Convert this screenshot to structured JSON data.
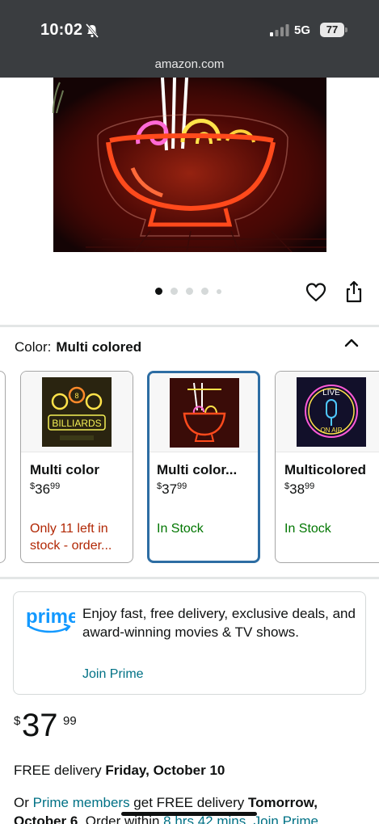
{
  "status_bar": {
    "time": "10:02",
    "network": "5G",
    "battery": "77"
  },
  "browser": {
    "url": "amazon.com"
  },
  "gallery": {
    "dots_total": 5,
    "active_index": 0
  },
  "color_selector": {
    "label": "Color:",
    "selected": "Multi colored",
    "options": [
      {
        "name": "Multi color",
        "price_whole": "36",
        "price_fraction": "99",
        "availability": "Only 11 left in stock - order...",
        "status": "low"
      },
      {
        "name": "Multi color...",
        "price_whole": "37",
        "price_fraction": "99",
        "availability": "In Stock",
        "status": "in_stock"
      },
      {
        "name": "Multicolored",
        "price_whole": "38",
        "price_fraction": "99",
        "availability": "In Stock",
        "status": "in_stock"
      }
    ]
  },
  "prime": {
    "logo_text": "prime",
    "message": "Enjoy fast, free delivery, exclusive deals, and award-winning movies & TV shows.",
    "link": "Join Prime"
  },
  "price": {
    "symbol": "$",
    "whole": "37",
    "fraction": "99"
  },
  "delivery": {
    "line1_prefix": "FREE delivery ",
    "line1_date": "Friday, October 10",
    "line2_or": "Or ",
    "line2_link": "Prime members",
    "line2_mid": " get FREE delivery ",
    "line2_date": "Tomorrow, October 6",
    "line2_order": ". Order within ",
    "line2_countdown": "8 hrs 42 mins",
    "line2_sep": ". ",
    "line2_join": "Join Prime"
  },
  "colors": {
    "link": "#007185",
    "in_stock": "#007600",
    "low_stock": "#b12704",
    "selected_border": "#2d6da3",
    "prime_blue": "#1399ff"
  }
}
